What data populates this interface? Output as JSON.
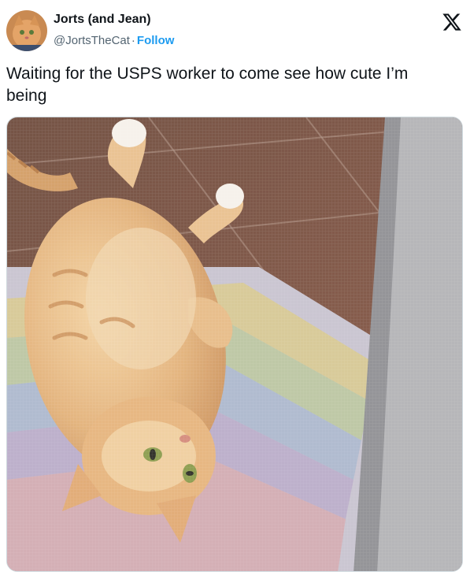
{
  "author": {
    "display_name": "Jorts (and Jean)",
    "handle": "@JortsTheCat",
    "separator": "·",
    "follow_label": "Follow"
  },
  "tweet": {
    "text": "Waiting for the USPS worker to come see how cute I’m being"
  },
  "media": {
    "icon": "cat-photo"
  },
  "brand": {
    "icon": "x-logo-icon",
    "follow_color": "#1d9bf0"
  }
}
